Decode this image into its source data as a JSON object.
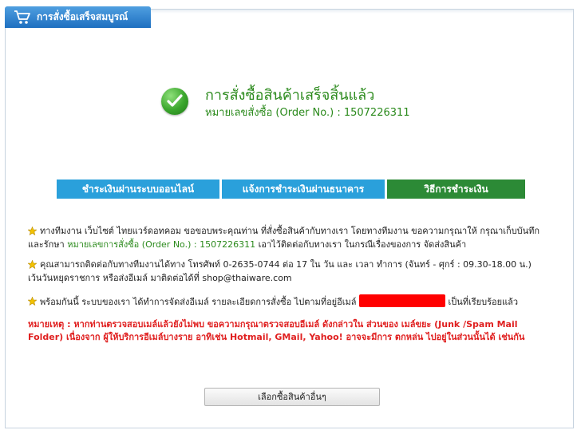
{
  "tab": {
    "title": "การสั่งซื้อเสร็จสมบูรณ์",
    "icon": "shopping-cart-icon"
  },
  "header": {
    "title": "การสั่งซื้อสินค้าเสร็จสิ้นแล้ว",
    "order_label": "หมายเลขสั่งซื้อ (Order No.) : 1507226311"
  },
  "buttons": {
    "pay_online": "ชำระเงินผ่านระบบออนไลน์",
    "notify_bank": "แจ้งการชำระเงินผ่านธนาคาร",
    "pay_method": "วิธีการชำระเงิน"
  },
  "paragraphs": {
    "p1_text": "ทางทีมงาน เว็บไซต์ ไทยแวร์ดอทคอม ขอขอบพระคุณท่าน ที่สั่งซื้อสินค้ากับทางเรา โดยทางทีมงาน ขอความกรุณาให้ กรุณาเก็บบันทึก และรักษา ",
    "p1_order": "หมายเลขการสั่งซื้อ (Order No.) : 1507226311",
    "p1_tail": " เอาไว้ติดต่อกับทางเรา ในกรณีเรื่องของการ จัดส่งสินค้า",
    "p2_text": "คุณสามารถติดต่อกับทางทีมงานได้ทาง โทรศัพท์ 0-2635-0744 ต่อ 17 ใน วัน และ เวลา ทำการ (จันทร์ - ศุกร์ : 09.30-18.00 น.) เว้นวันหยุดราชการ หรือส่งอีเมล์ มาติดต่อได้ที่ shop@thaiware.com",
    "p3_text": "พร้อมกันนี้ ระบบของเรา ได้ทำการจัดส่งอีเมล์ รายละเอียดการสั่งซื้อ ไปตามที่อยู่อีเมล์ ",
    "p3_tail": " เป็นที่เรียบร้อยแล้ว"
  },
  "note": "หมายเหตุ : หากท่านตรวจสอบเมล์แล้วยังไม่พบ ขอความกรุณาตรวจสอบอีเมล์ ดังกล่าวใน ส่วนของ เมล์ขยะ (Junk /Spam Mail Folder) เนื่องจาก ผู้ให้บริการอีเมล์บางราย อาทิเช่น Hotmail, GMail, Yahoo! อาจจะมีการ ตกหล่น ไปอยู่ในส่วนนั้นได้ เช่นกัน",
  "continue_button": "เลือกซื้อสินค้าอื่นๆ",
  "colors": {
    "accent_blue": "#2aa0db",
    "accent_green": "#2c8a36",
    "success_green": "#2b8a1c",
    "note_red": "#e02020"
  }
}
